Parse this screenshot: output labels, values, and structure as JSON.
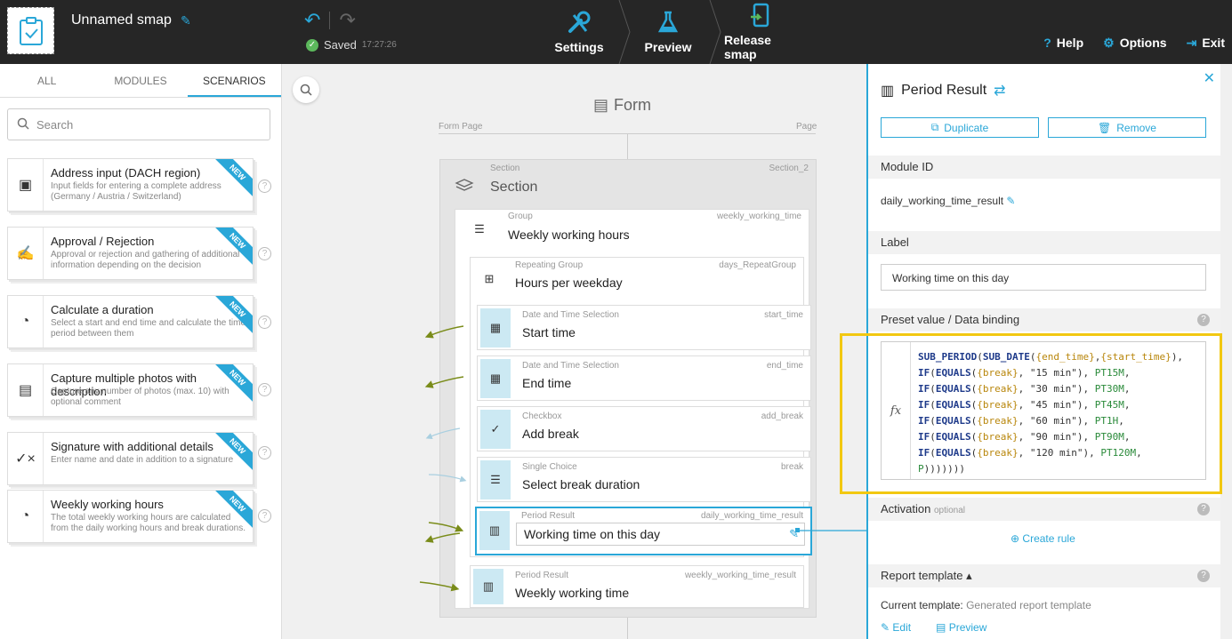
{
  "app": {
    "title": "Unnamed smap",
    "saved_label": "Saved",
    "saved_time": "17:27:26"
  },
  "topnav": {
    "settings": "Settings",
    "preview": "Preview",
    "release": "Release smap"
  },
  "right_actions": {
    "help": "Help",
    "options": "Options",
    "exit": "Exit"
  },
  "left": {
    "tabs": [
      "ALL",
      "MODULES",
      "SCENARIOS"
    ],
    "search_placeholder": "Search",
    "badge": "NEW",
    "modules": [
      {
        "title": "Address input (DACH region)",
        "desc": "Input fields for entering a complete address (Germany / Austria / Switzerland)",
        "icon": "address-card-icon"
      },
      {
        "title": "Approval / Rejection",
        "desc": "Approval or rejection and gathering of additional information depending on the decision",
        "icon": "signature-pen-icon"
      },
      {
        "title": "Calculate a duration",
        "desc": "Select a start and end time and calculate the time period between them",
        "icon": "duration-icon"
      },
      {
        "title": "Capture multiple photos with description",
        "desc": "Capture any number of photos (max. 10) with optional comment",
        "icon": "photos-icon"
      },
      {
        "title": "Signature with additional details",
        "desc": "Enter name and date in addition to a signature",
        "icon": "signature-icon"
      },
      {
        "title": "Weekly working hours",
        "desc": "The total weekly working hours are calculated from the daily working hours and break durations.",
        "icon": "duration-icon"
      }
    ]
  },
  "canvas": {
    "form_title": "Form",
    "form_page_left": "Form Page",
    "form_page_right": "Page",
    "section": {
      "label": "Section",
      "id": "Section_2",
      "title": "Section"
    },
    "group": {
      "label": "Group",
      "id": "weekly_working_time",
      "title": "Weekly working hours"
    },
    "repeat": {
      "label": "Repeating Group",
      "id": "days_RepeatGroup",
      "title": "Hours per weekday"
    },
    "elements": [
      {
        "label": "Date and Time Selection",
        "id": "start_time",
        "title": "Start time"
      },
      {
        "label": "Date and Time Selection",
        "id": "end_time",
        "title": "End time"
      },
      {
        "label": "Checkbox",
        "id": "add_break",
        "title": "Add break"
      },
      {
        "label": "Single Choice",
        "id": "break",
        "title": "Select break duration"
      },
      {
        "label": "Period Result",
        "id": "daily_working_time_result",
        "title": "Working time on this day"
      }
    ],
    "outer_element": {
      "label": "Period Result",
      "id": "weekly_working_time_result",
      "title": "Weekly working time"
    }
  },
  "panel": {
    "title": "Period Result",
    "duplicate": "Duplicate",
    "remove": "Remove",
    "module_id_label": "Module ID",
    "module_id_value": "daily_working_time_result",
    "label_label": "Label",
    "label_value": "Working time on this day",
    "preset_label": "Preset value / Data binding",
    "activation_label": "Activation",
    "activation_optional": "optional",
    "create_rule": "Create rule",
    "report_label": "Report template",
    "current_template_label": "Current template:",
    "current_template_value": "Generated report template",
    "edit": "Edit",
    "preview": "Preview",
    "fx": "fx"
  },
  "colors": {
    "accent": "#2aa7d8",
    "highlight": "#f2c811",
    "topbar": "#262626"
  }
}
